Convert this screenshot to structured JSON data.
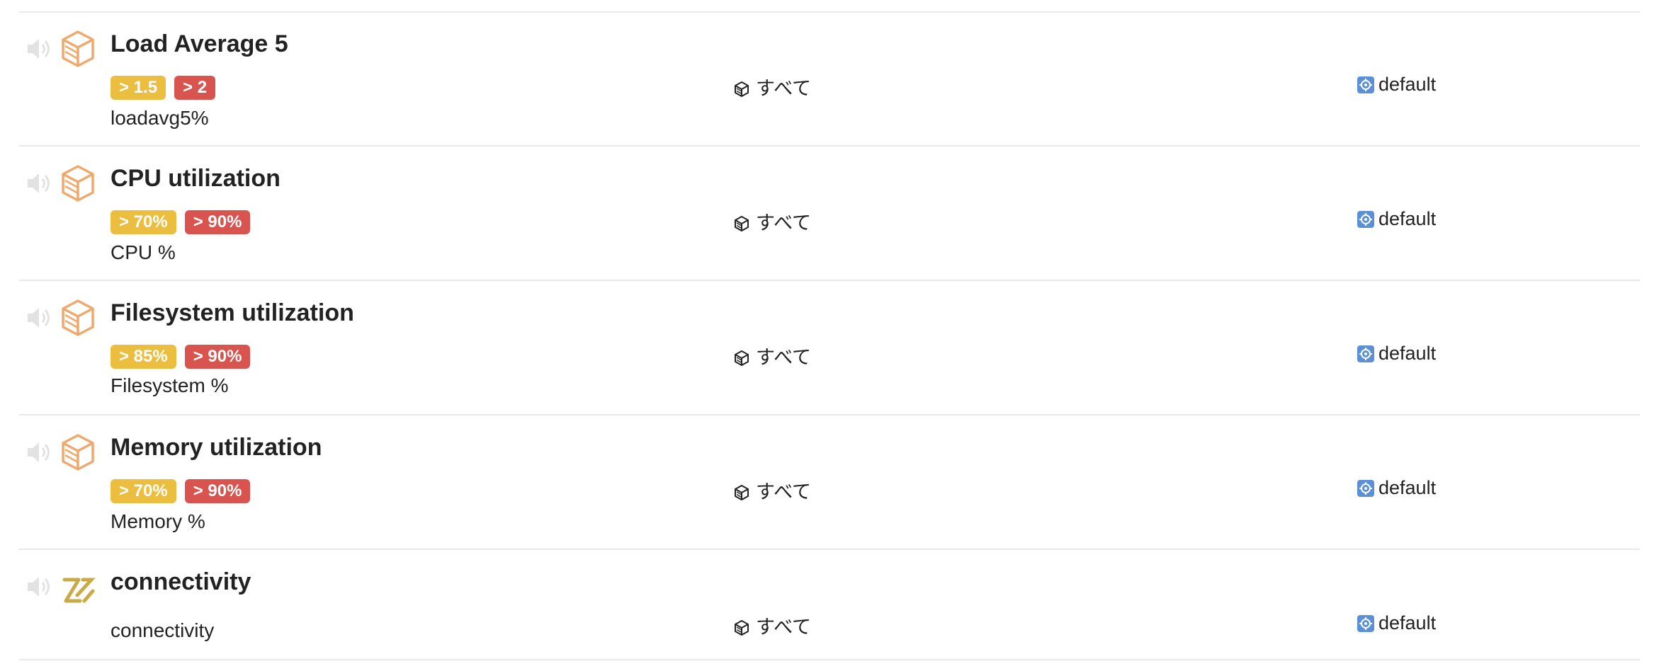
{
  "colors": {
    "warning": "#ebbe3f",
    "critical": "#d9534f",
    "monitor_icon": "#f0a96c",
    "connectivity_icon": "#c9aa45",
    "channel_icon": "#5b8fd6",
    "divider": "#e9e9e9"
  },
  "monitors": [
    {
      "name": "Load Average 5",
      "warning": "> 1.5",
      "critical": "> 2",
      "metric": "loadavg5%",
      "scope": "すべて",
      "channel": "default",
      "icon": "box-icon"
    },
    {
      "name": "CPU utilization",
      "warning": "> 70%",
      "critical": "> 90%",
      "metric": "CPU %",
      "scope": "すべて",
      "channel": "default",
      "icon": "box-icon"
    },
    {
      "name": "Filesystem utilization",
      "warning": "> 85%",
      "critical": "> 90%",
      "metric": "Filesystem %",
      "scope": "すべて",
      "channel": "default",
      "icon": "box-icon"
    },
    {
      "name": "Memory utilization",
      "warning": "> 70%",
      "critical": "> 90%",
      "metric": "Memory %",
      "scope": "すべて",
      "channel": "default",
      "icon": "box-icon"
    },
    {
      "name": "connectivity",
      "metric": "connectivity",
      "scope": "すべて",
      "channel": "default",
      "icon": "connectivity-icon"
    }
  ]
}
